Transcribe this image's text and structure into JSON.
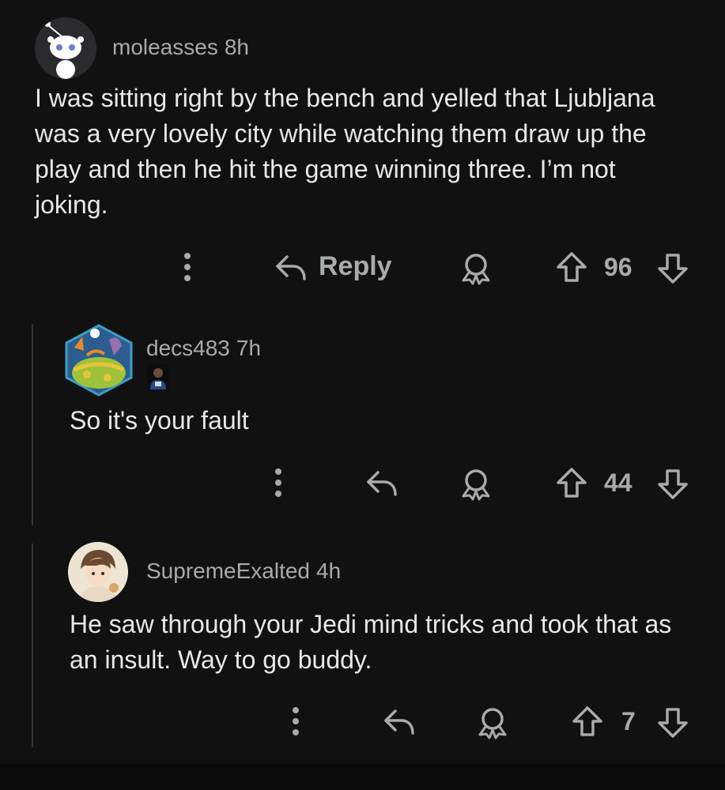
{
  "comments": [
    {
      "username": "moleasses",
      "time": "8h",
      "text": "I was sitting right by the bench and yelled that Ljubljana was a very lovely city while watching them draw up the play and then he hit the game winning three. I’m not joking.",
      "reply_label": "Reply",
      "score": "96"
    },
    {
      "username": "decs483",
      "time": "7h",
      "text": "So it's your fault",
      "score": "44"
    },
    {
      "username": "SupremeExalted",
      "time": "4h",
      "text": "He saw through your Jedi mind tricks and took that as an insult. Way to go buddy.",
      "score": "7"
    }
  ],
  "icons": [
    "more-options-icon",
    "reply-arrow-icon",
    "award-icon",
    "upvote-icon",
    "downvote-icon"
  ],
  "colors": {
    "background": "#111111",
    "text": "#e8e8e8",
    "muted": "#a8aaab"
  }
}
